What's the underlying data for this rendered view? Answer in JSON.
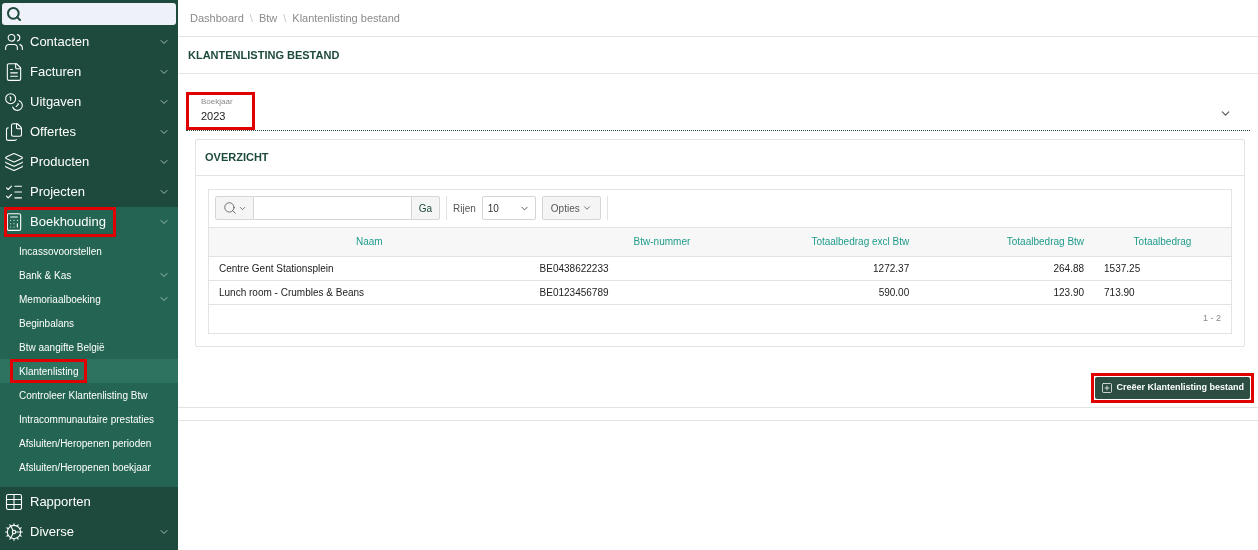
{
  "sidebar": {
    "items": [
      {
        "label": "Contacten",
        "expandable": true,
        "expanded": false,
        "highlighted": false
      },
      {
        "label": "Facturen",
        "expandable": true,
        "expanded": false,
        "highlighted": false
      },
      {
        "label": "Uitgaven",
        "expandable": true,
        "expanded": false,
        "highlighted": false
      },
      {
        "label": "Offertes",
        "expandable": true,
        "expanded": false,
        "highlighted": false
      },
      {
        "label": "Producten",
        "expandable": true,
        "expanded": false,
        "highlighted": false
      },
      {
        "label": "Projecten",
        "expandable": true,
        "expanded": false,
        "highlighted": false
      },
      {
        "label": "Boekhouding",
        "expandable": true,
        "expanded": true,
        "highlighted": true,
        "children": [
          {
            "label": "Incassovoorstellen",
            "expandable": false,
            "selected": false,
            "highlighted": false
          },
          {
            "label": "Bank & Kas",
            "expandable": true,
            "selected": false,
            "highlighted": false
          },
          {
            "label": "Memoriaalboeking",
            "expandable": true,
            "selected": false,
            "highlighted": false
          },
          {
            "label": "Beginbalans",
            "expandable": false,
            "selected": false,
            "highlighted": false
          },
          {
            "label": "Btw aangifte België",
            "expandable": false,
            "selected": false,
            "highlighted": false
          },
          {
            "label": "Klantenlisting",
            "expandable": false,
            "selected": true,
            "highlighted": true
          },
          {
            "label": "Controleer Klantenlisting Btw",
            "expandable": false,
            "selected": false,
            "highlighted": false
          },
          {
            "label": "Intracommunautaire prestaties",
            "expandable": false,
            "selected": false,
            "highlighted": false
          },
          {
            "label": "Afsluiten/Heropenen perioden",
            "expandable": false,
            "selected": false,
            "highlighted": false
          },
          {
            "label": "Afsluiten/Heropenen boekjaar",
            "expandable": false,
            "selected": false,
            "highlighted": false
          }
        ]
      },
      {
        "label": "Rapporten",
        "expandable": false,
        "expanded": false,
        "highlighted": false
      },
      {
        "label": "Diverse",
        "expandable": true,
        "expanded": false,
        "highlighted": false
      }
    ]
  },
  "breadcrumb": {
    "separator": "\\",
    "items": [
      "Dashboard",
      "Btw",
      "Klantenlisting bestand"
    ]
  },
  "page_title": "KLANTENLISTING BESTAND",
  "year_field": {
    "label": "Boekjaar",
    "value": "2023",
    "highlighted": true
  },
  "panel": {
    "title": "OVERZICHT",
    "toolbar": {
      "go_button": "Ga",
      "rows_label": "Rijen",
      "rows_value": "10",
      "options_button": "Opties"
    },
    "table": {
      "columns": [
        "Naam",
        "Btw-nummer",
        "Totaalbedrag excl Btw",
        "Totaalbedrag Btw",
        "Totaalbedrag"
      ],
      "rows": [
        [
          "Centre Gent Stationsplein",
          "BE0438622233",
          "1272.37",
          "264.88",
          "1537.25"
        ],
        [
          "Lunch room - Crumbles & Beans",
          "BE0123456789",
          "590.00",
          "123.90",
          "713.90"
        ]
      ]
    },
    "pagination": "1 - 2"
  },
  "create_button": {
    "label": "Creëer Klantenlisting bestand",
    "highlighted": true
  }
}
